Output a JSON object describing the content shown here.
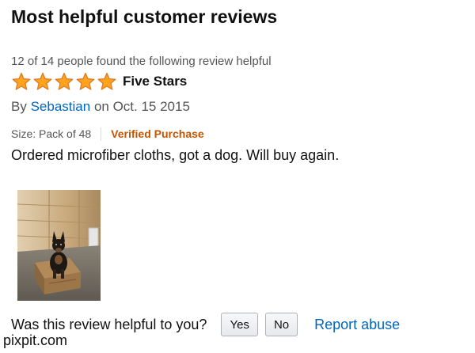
{
  "section": {
    "title": "Most helpful customer reviews"
  },
  "review": {
    "helpful_count": "12 of 14 people found the following review helpful",
    "rating": 5,
    "rating_max": 5,
    "title": "Five Stars",
    "by_prefix": "By",
    "author": "Sebastian",
    "date": "on Oct. 15 2015",
    "size": "Size: Pack of 48",
    "verified": "Verified Purchase",
    "body": "Ordered microfiber cloths, got a dog. Will buy again."
  },
  "helpful": {
    "question": "Was this review helpful to you?",
    "yes_label": "Yes",
    "no_label": "No",
    "report_label": "Report abuse"
  },
  "watermark": "pixpit.com",
  "colors": {
    "star_fill": "#ffa41c",
    "star_stroke": "#de7921",
    "link": "#0066c0",
    "verified": "#c45500"
  },
  "icons": {
    "star": "star-icon"
  }
}
